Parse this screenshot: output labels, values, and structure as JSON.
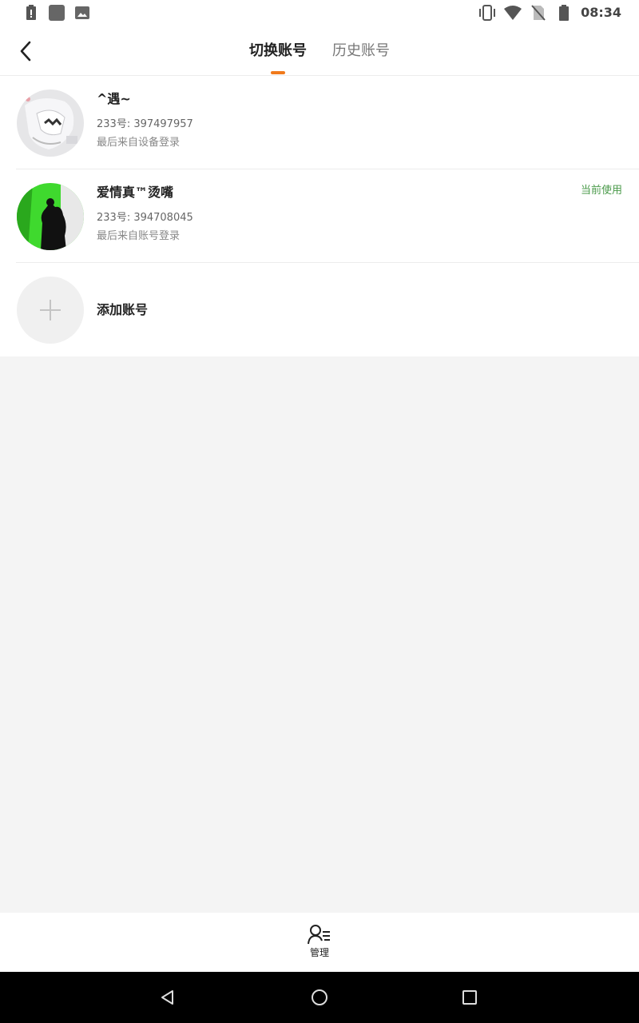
{
  "status_bar": {
    "time": "08:34",
    "left_icons": [
      "battery-alert-icon",
      "square-app-icon",
      "image-icon"
    ],
    "right_icons": [
      "vibrate-icon",
      "wifi-icon",
      "no-sim-icon",
      "battery-icon"
    ]
  },
  "header": {
    "tabs": [
      {
        "label": "切换账号",
        "active": true
      },
      {
        "label": "历史账号",
        "active": false
      }
    ],
    "accent": "#f07a1c"
  },
  "accounts": [
    {
      "name": "^遇~",
      "uid": "233号: 397497957",
      "login_source": "最后来自设备登录",
      "current": ""
    },
    {
      "name": "爱情真™烫嘴",
      "uid": "233号: 394708045",
      "login_source": "最后来自账号登录",
      "current": "当前使用"
    }
  ],
  "add_account": {
    "label": "添加账号"
  },
  "bottom_bar": {
    "manage_label": "管理"
  },
  "colors": {
    "current_green": "#4a9a4a",
    "background": "#f4f4f4"
  }
}
